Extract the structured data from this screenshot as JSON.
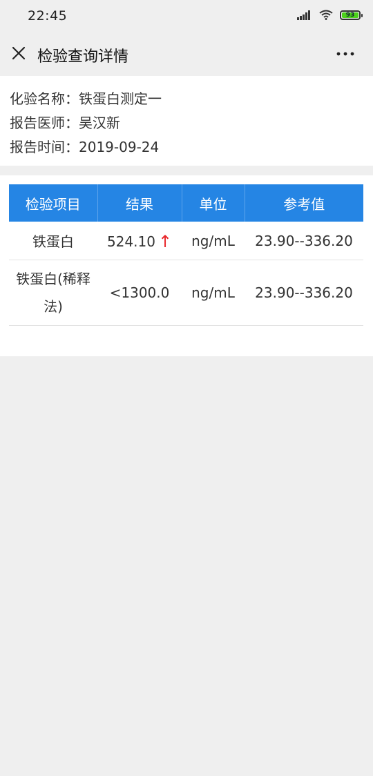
{
  "status_bar": {
    "time": "22:45",
    "battery": "93"
  },
  "header": {
    "title": "检验查询详情"
  },
  "report": {
    "test_name_label": "化验名称：",
    "test_name": "铁蛋白测定一",
    "doctor_label": "报告医师：",
    "doctor": "吴汉新",
    "time_label": "报告时间：",
    "time": "2019-09-24"
  },
  "table": {
    "headers": [
      "检验项目",
      "结果",
      "单位",
      "参考值"
    ],
    "rows": [
      {
        "item": "铁蛋白",
        "result": "524.10",
        "flag": "↑",
        "unit": "ng/mL",
        "reference": "23.90--336.20"
      },
      {
        "item": "铁蛋白(稀释法)",
        "result": "<1300.0",
        "flag": "",
        "unit": "ng/mL",
        "reference": "23.90--336.20"
      }
    ]
  },
  "colors": {
    "header_blue": "#2585e4",
    "abnormal_red": "#e8272b",
    "page_bg": "#efefef"
  }
}
